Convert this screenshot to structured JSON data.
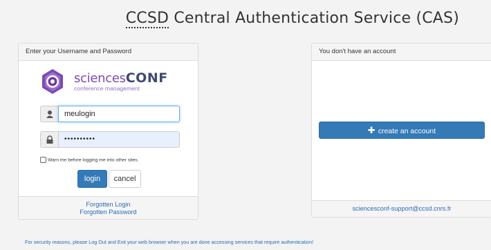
{
  "header": {
    "abbr": "CCSD",
    "title_rest": " Central Authentication Service (CAS)"
  },
  "login_panel": {
    "heading": "Enter your Username and Password",
    "logo": {
      "text_sci": "sciences",
      "text_conf": "CONF",
      "subtitle": "conference management",
      "icon": "sciencesconf-logo-icon"
    },
    "username": {
      "value": "meulogin",
      "icon": "user-icon"
    },
    "password": {
      "value": "••••••••••",
      "icon": "lock-icon"
    },
    "warn_label": "Warn me before logging me into other sites.",
    "login_label": "login",
    "cancel_label": "cancel",
    "forgotten_login": "Forgotten Login",
    "forgotten_password": "Forgotten Password"
  },
  "account_panel": {
    "heading": "You don't have an account",
    "create_label": "create an account",
    "support_email": "sciencesconf-support@ccsd.cnrs.fr"
  },
  "security_note": "For security reasons, please Log Out and Exit your web browser when you are done accessing services that require authentication!",
  "colors": {
    "primary": "#337ab7",
    "link": "#2a6ab4",
    "brand_purple": "#7b4bb0",
    "brand_navy": "#3f4a70"
  }
}
